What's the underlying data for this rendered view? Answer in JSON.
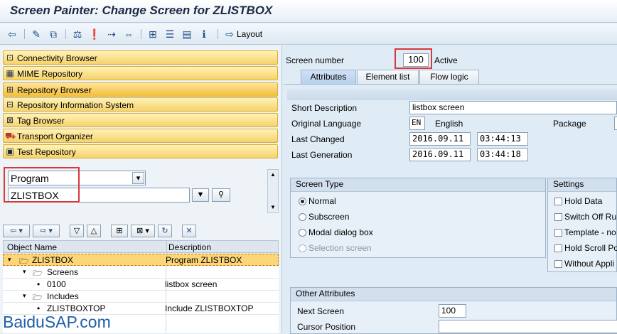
{
  "window_title": "Screen Painter: Change Screen for ZLISTBOX",
  "toolbar": {
    "layout_label": "Layout"
  },
  "nav_buttons": [
    {
      "label": "Connectivity Browser"
    },
    {
      "label": "MIME Repository"
    },
    {
      "label": "Repository Browser"
    },
    {
      "label": "Repository Information System"
    },
    {
      "label": "Tag Browser"
    },
    {
      "label": "Transport Organizer"
    },
    {
      "label": "Test Repository"
    }
  ],
  "object_selector": {
    "type_value": "Program",
    "name_value": "ZLISTBOX"
  },
  "tree": {
    "col_object_name": "Object Name",
    "col_description": "Description",
    "rows": [
      {
        "name": "ZLISTBOX",
        "desc": "Program ZLISTBOX"
      },
      {
        "name": "Screens",
        "desc": ""
      },
      {
        "name": "0100",
        "desc": "listbox screen"
      },
      {
        "name": "Includes",
        "desc": ""
      },
      {
        "name": "ZLISTBOXTOP",
        "desc": "Include ZLISTBOXTOP"
      }
    ]
  },
  "screen": {
    "number_label": "Screen number",
    "number_value": "100",
    "status": "Active"
  },
  "tabs": [
    {
      "label": "Attributes"
    },
    {
      "label": "Element list"
    },
    {
      "label": "Flow logic"
    }
  ],
  "attributes": {
    "short_desc_label": "Short Description",
    "short_desc_value": "listbox screen",
    "orig_lang_label": "Original Language",
    "orig_lang_code": "EN",
    "orig_lang_name": "English",
    "package_label": "Package",
    "last_changed_label": "Last Changed",
    "last_changed_date": "2016.09.11",
    "last_changed_time": "03:44:13",
    "last_gen_label": "Last Generation",
    "last_gen_date": "2016.09.11",
    "last_gen_time": "03:44:18"
  },
  "screen_type": {
    "title": "Screen Type",
    "options": [
      {
        "label": "Normal"
      },
      {
        "label": "Subscreen"
      },
      {
        "label": "Modal dialog box"
      },
      {
        "label": "Selection screen"
      }
    ]
  },
  "settings": {
    "title": "Settings",
    "options": [
      {
        "label": "Hold Data"
      },
      {
        "label": "Switch Off Ru"
      },
      {
        "label": "Template - no"
      },
      {
        "label": "Hold Scroll Pos"
      },
      {
        "label": "Without Appli"
      }
    ]
  },
  "other_attributes": {
    "title": "Other Attributes",
    "next_screen_label": "Next Screen",
    "next_screen_value": "100",
    "cursor_pos_label": "Cursor Position"
  },
  "watermark": "BaiduSAP.com"
}
